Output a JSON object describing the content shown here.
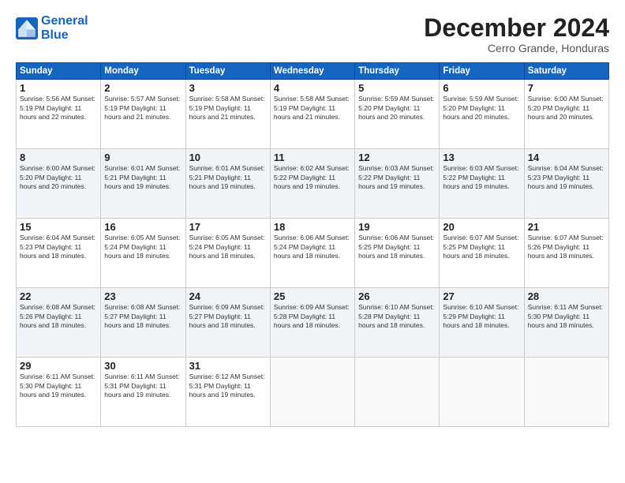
{
  "logo": {
    "line1": "General",
    "line2": "Blue"
  },
  "title": "December 2024",
  "subtitle": "Cerro Grande, Honduras",
  "header_days": [
    "Sunday",
    "Monday",
    "Tuesday",
    "Wednesday",
    "Thursday",
    "Friday",
    "Saturday"
  ],
  "weeks": [
    [
      {
        "day": "1",
        "info": "Sunrise: 5:56 AM\nSunset: 5:19 PM\nDaylight: 11 hours\nand 22 minutes."
      },
      {
        "day": "2",
        "info": "Sunrise: 5:57 AM\nSunset: 5:19 PM\nDaylight: 11 hours\nand 21 minutes."
      },
      {
        "day": "3",
        "info": "Sunrise: 5:58 AM\nSunset: 5:19 PM\nDaylight: 11 hours\nand 21 minutes."
      },
      {
        "day": "4",
        "info": "Sunrise: 5:58 AM\nSunset: 5:19 PM\nDaylight: 11 hours\nand 21 minutes."
      },
      {
        "day": "5",
        "info": "Sunrise: 5:59 AM\nSunset: 5:20 PM\nDaylight: 11 hours\nand 20 minutes."
      },
      {
        "day": "6",
        "info": "Sunrise: 5:59 AM\nSunset: 5:20 PM\nDaylight: 11 hours\nand 20 minutes."
      },
      {
        "day": "7",
        "info": "Sunrise: 6:00 AM\nSunset: 5:20 PM\nDaylight: 11 hours\nand 20 minutes."
      }
    ],
    [
      {
        "day": "8",
        "info": "Sunrise: 6:00 AM\nSunset: 5:20 PM\nDaylight: 11 hours\nand 20 minutes."
      },
      {
        "day": "9",
        "info": "Sunrise: 6:01 AM\nSunset: 5:21 PM\nDaylight: 11 hours\nand 19 minutes."
      },
      {
        "day": "10",
        "info": "Sunrise: 6:01 AM\nSunset: 5:21 PM\nDaylight: 11 hours\nand 19 minutes."
      },
      {
        "day": "11",
        "info": "Sunrise: 6:02 AM\nSunset: 5:22 PM\nDaylight: 11 hours\nand 19 minutes."
      },
      {
        "day": "12",
        "info": "Sunrise: 6:03 AM\nSunset: 5:22 PM\nDaylight: 11 hours\nand 19 minutes."
      },
      {
        "day": "13",
        "info": "Sunrise: 6:03 AM\nSunset: 5:22 PM\nDaylight: 11 hours\nand 19 minutes."
      },
      {
        "day": "14",
        "info": "Sunrise: 6:04 AM\nSunset: 5:23 PM\nDaylight: 11 hours\nand 19 minutes."
      }
    ],
    [
      {
        "day": "15",
        "info": "Sunrise: 6:04 AM\nSunset: 5:23 PM\nDaylight: 11 hours\nand 18 minutes."
      },
      {
        "day": "16",
        "info": "Sunrise: 6:05 AM\nSunset: 5:24 PM\nDaylight: 11 hours\nand 18 minutes."
      },
      {
        "day": "17",
        "info": "Sunrise: 6:05 AM\nSunset: 5:24 PM\nDaylight: 11 hours\nand 18 minutes."
      },
      {
        "day": "18",
        "info": "Sunrise: 6:06 AM\nSunset: 5:24 PM\nDaylight: 11 hours\nand 18 minutes."
      },
      {
        "day": "19",
        "info": "Sunrise: 6:06 AM\nSunset: 5:25 PM\nDaylight: 11 hours\nand 18 minutes."
      },
      {
        "day": "20",
        "info": "Sunrise: 6:07 AM\nSunset: 5:25 PM\nDaylight: 11 hours\nand 18 minutes."
      },
      {
        "day": "21",
        "info": "Sunrise: 6:07 AM\nSunset: 5:26 PM\nDaylight: 11 hours\nand 18 minutes."
      }
    ],
    [
      {
        "day": "22",
        "info": "Sunrise: 6:08 AM\nSunset: 5:26 PM\nDaylight: 11 hours\nand 18 minutes."
      },
      {
        "day": "23",
        "info": "Sunrise: 6:08 AM\nSunset: 5:27 PM\nDaylight: 11 hours\nand 18 minutes."
      },
      {
        "day": "24",
        "info": "Sunrise: 6:09 AM\nSunset: 5:27 PM\nDaylight: 11 hours\nand 18 minutes."
      },
      {
        "day": "25",
        "info": "Sunrise: 6:09 AM\nSunset: 5:28 PM\nDaylight: 11 hours\nand 18 minutes."
      },
      {
        "day": "26",
        "info": "Sunrise: 6:10 AM\nSunset: 5:28 PM\nDaylight: 11 hours\nand 18 minutes."
      },
      {
        "day": "27",
        "info": "Sunrise: 6:10 AM\nSunset: 5:29 PM\nDaylight: 11 hours\nand 18 minutes."
      },
      {
        "day": "28",
        "info": "Sunrise: 6:11 AM\nSunset: 5:30 PM\nDaylight: 11 hours\nand 18 minutes."
      }
    ],
    [
      {
        "day": "29",
        "info": "Sunrise: 6:11 AM\nSunset: 5:30 PM\nDaylight: 11 hours\nand 19 minutes."
      },
      {
        "day": "30",
        "info": "Sunrise: 6:11 AM\nSunset: 5:31 PM\nDaylight: 11 hours\nand 19 minutes."
      },
      {
        "day": "31",
        "info": "Sunrise: 6:12 AM\nSunset: 5:31 PM\nDaylight: 11 hours\nand 19 minutes."
      },
      {
        "day": "",
        "info": ""
      },
      {
        "day": "",
        "info": ""
      },
      {
        "day": "",
        "info": ""
      },
      {
        "day": "",
        "info": ""
      }
    ]
  ]
}
